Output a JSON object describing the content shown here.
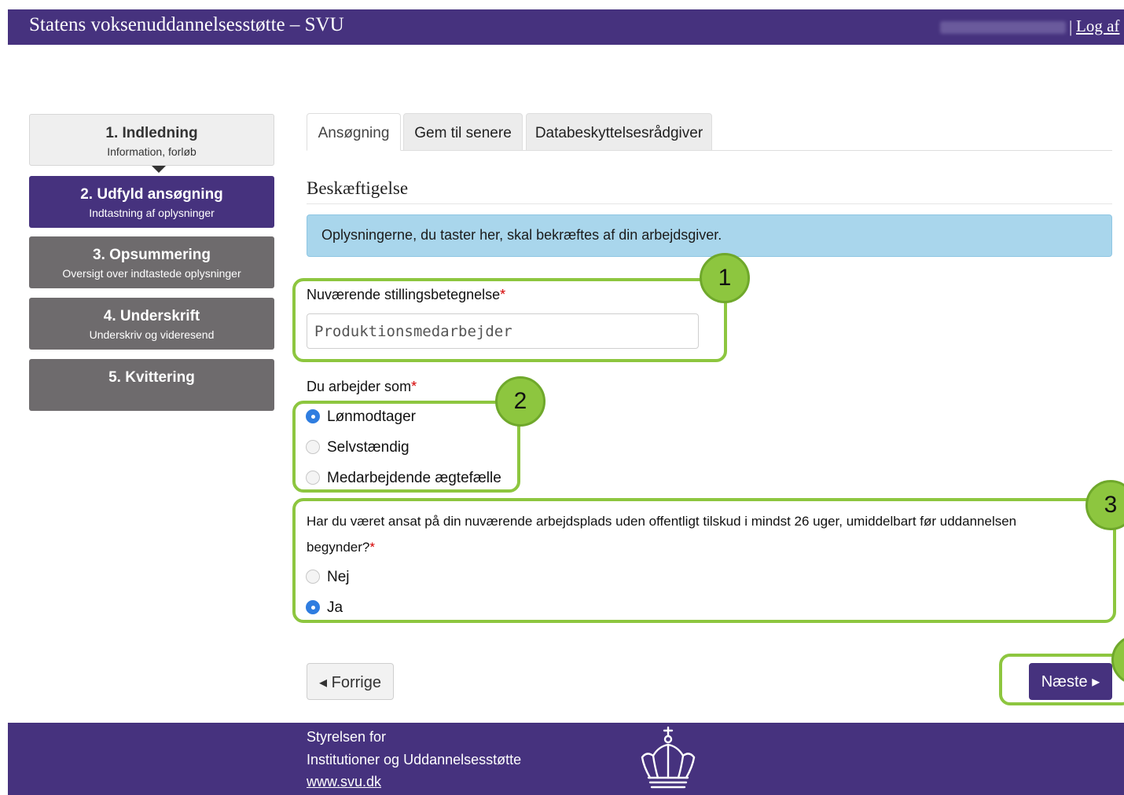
{
  "header": {
    "title": "Statens voksenuddannelsesstøtte – SVU",
    "separator": "|",
    "logout": "Log af"
  },
  "steps": [
    {
      "title": "1. Indledning",
      "subtitle": "Information, forløb"
    },
    {
      "title": "2. Udfyld ansøgning",
      "subtitle": "Indtastning af oplysninger"
    },
    {
      "title": "3. Opsummering",
      "subtitle": "Oversigt over indtastede oplysninger"
    },
    {
      "title": "4. Underskrift",
      "subtitle": "Underskriv og videresend"
    },
    {
      "title": "5. Kvittering",
      "subtitle": ""
    }
  ],
  "tabs": [
    "Ansøgning",
    "Gem til senere",
    "Databeskyttelsesrådgiver"
  ],
  "section": {
    "title": "Beskæftigelse",
    "info": "Oplysningerne, du taster her, skal bekræftes af din arbejdsgiver."
  },
  "form": {
    "job_title_label": "Nuværende stillingsbetegnelse",
    "job_title_value": "Produktionsmedarbejder",
    "required_mark": "*",
    "work_as_label": "Du arbejder som",
    "work_as_options": [
      "Lønmodtager",
      "Selvstændig",
      "Medarbejdende ægtefælle"
    ],
    "work_as_selected": "Lønmodtager",
    "employment_question_line1": "Har du været ansat på din nuværende arbejdsplads uden offentligt tilskud i mindst 26 uger, umiddelbart før uddannelsen",
    "employment_question_line2": "begynder?",
    "employment_options": [
      "Nej",
      "Ja"
    ],
    "employment_selected": "Ja"
  },
  "annotations": [
    "1",
    "2",
    "3"
  ],
  "buttons": {
    "prev": "◂ Forrige",
    "next": "Næste ▸"
  },
  "footer": {
    "line1": "Styrelsen for",
    "line2": "Institutioner og Uddannelsesstøtte",
    "link": "www.svu.dk"
  },
  "colors": {
    "brand_purple": "#46327e",
    "info_blue": "#a9d6ec",
    "annotation_green": "#8dc63f",
    "radio_blue": "#2f7de0"
  }
}
